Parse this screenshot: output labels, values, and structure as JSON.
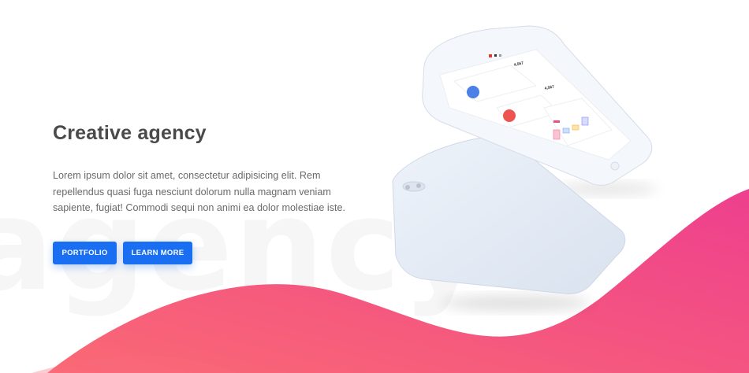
{
  "background_word": "agency",
  "hero": {
    "title": "Creative agency",
    "description": "Lorem ipsum dolor sit amet, consectetur adipisicing elit. Rem repellendus quasi fuga nesciunt dolorum nulla magnam veniam sapiente, fugiat! Commodi sequi non animi ea dolor molestiae iste."
  },
  "buttons": {
    "portfolio": "PORTFOLIO",
    "learn_more": "LEARN MORE"
  },
  "phone_screen": {
    "stat_1": "4,567",
    "stat_2": "4,567"
  },
  "colors": {
    "accent": "#1a6ef2",
    "wave_start": "#f9607a",
    "wave_end": "#f0438e",
    "title": "#4a4a4a"
  }
}
